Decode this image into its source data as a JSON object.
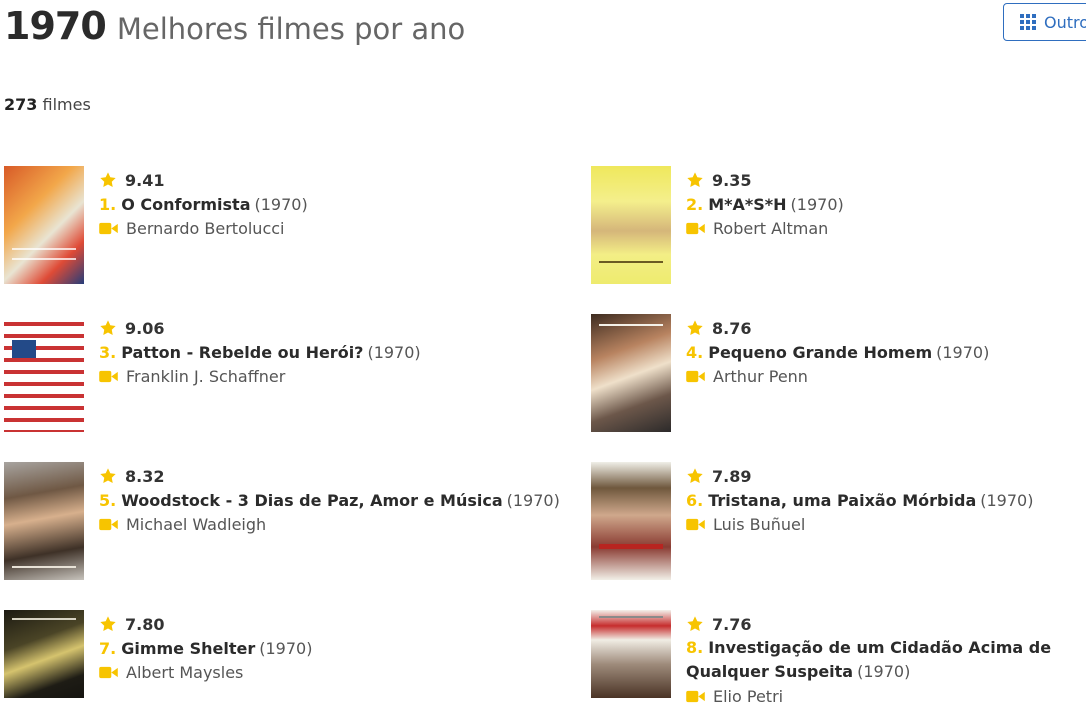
{
  "header": {
    "year": "1970",
    "subtitle": "Melhores filmes por ano",
    "other_button": "Outro"
  },
  "summary": {
    "count": "273",
    "count_label": "filmes"
  },
  "movies": [
    {
      "rating": "9.41",
      "rank": "1.",
      "title": "O Conformista",
      "year": "(1970)",
      "director": "Bernardo Bertolucci"
    },
    {
      "rating": "9.35",
      "rank": "2.",
      "title": "M*A*S*H",
      "year": "(1970)",
      "director": "Robert Altman"
    },
    {
      "rating": "9.06",
      "rank": "3.",
      "title": "Patton - Rebelde ou Herói?",
      "year": "(1970)",
      "director": "Franklin J. Schaffner"
    },
    {
      "rating": "8.76",
      "rank": "4.",
      "title": "Pequeno Grande Homem",
      "year": "(1970)",
      "director": "Arthur Penn"
    },
    {
      "rating": "8.32",
      "rank": "5.",
      "title": "Woodstock - 3 Dias de Paz, Amor e Música",
      "year": "(1970)",
      "director": "Michael Wadleigh"
    },
    {
      "rating": "7.89",
      "rank": "6.",
      "title": "Tristana, uma Paixão Mórbida",
      "year": "(1970)",
      "director": "Luis Buñuel"
    },
    {
      "rating": "7.80",
      "rank": "7.",
      "title": "Gimme Shelter",
      "year": "(1970)",
      "director": "Albert Maysles"
    },
    {
      "rating": "7.76",
      "rank": "8.",
      "title": "Investigação de um Cidadão Acima de Qualquer Suspeita",
      "year": "(1970)",
      "director": "Elio Petri"
    }
  ],
  "colors": {
    "accent": "#f7c400",
    "button": "#2f6ebf"
  },
  "icons": {
    "rating": "star-icon",
    "director": "video-camera-icon",
    "button": "grid-icon"
  }
}
